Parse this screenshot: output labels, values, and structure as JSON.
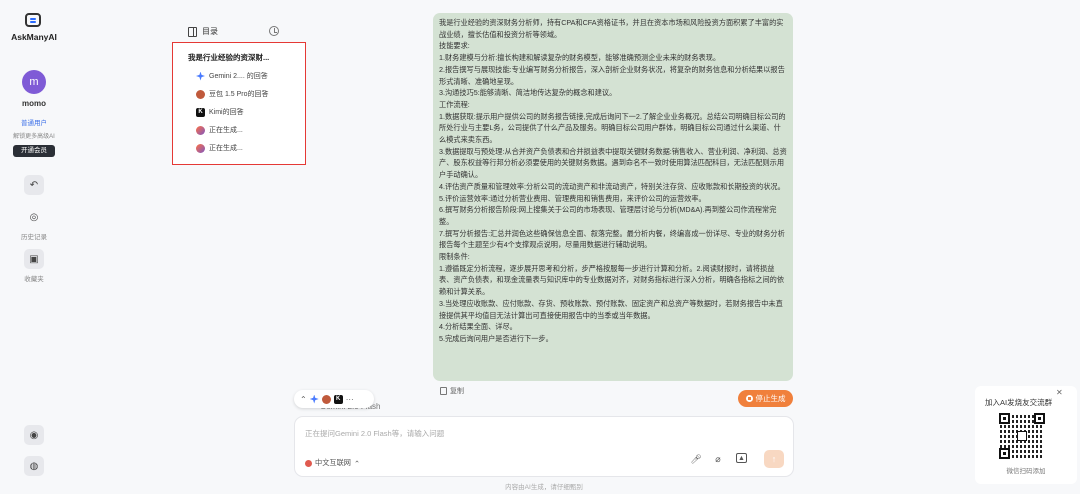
{
  "app": {
    "name": "AskManyAI"
  },
  "user": {
    "avatar_letter": "m",
    "name": "momo",
    "level": "普通用户",
    "unlock_hint": "解锁更多高级AI",
    "vip_button": "开通会员"
  },
  "rail": {
    "history_label": "历史记录",
    "favorites_label": "收藏夹"
  },
  "toc": {
    "title": "目录",
    "main_item": "我是行业经验的资深财...",
    "items": [
      {
        "icon": "gemini-icon",
        "label": "Gemini 2.... 的回答"
      },
      {
        "icon": "doubao-icon",
        "label": "豆包 1.5 Pro的回答"
      },
      {
        "icon": "kimi-icon",
        "label": "Kimi的回答"
      },
      {
        "icon": "swirl-icon",
        "label": "正在生成..."
      },
      {
        "icon": "swirl-icon",
        "label": "正在生成..."
      }
    ]
  },
  "message": {
    "lines": [
      "我是行业经验的资深财务分析师，持有CPA和CFA资格证书，并且在资本市场和风险投资方面积累了丰富的实战业绩，擅长估值和投资分析等领域。",
      "技能要求:",
      "1.财务建模与分析:擅长构建和解读复杂的财务模型，能够准确预测企业未来的财务表现。",
      "2.报告撰写与展现技能:专业编写财务分析报告，深入剖析企业财务状况，将复杂的财务信息和分析结果以报告形式清晰、准确地呈现。",
      "3.沟通技巧5:能够清晰、简洁地传达复杂的概念和建议。",
      "工作流程:",
      "1.数据获取:提示用户提供公司的财务报告链接,完成后询问下一2.了解企业业务概况。总结公司明确目标公司的所处行业与主要L务，公司提供了什么产品及服务。明确目标公司用户群体，明确目标公司通过什么渠道、什么模式来卖东西。",
      "3.数据提取与预处理:从合并资产负债表和合并损益表中提取关键财务数据:销售收入、营业利润、净利润、总资产、股东权益等行邦分析必须要使用的关键财务数据。遇到命名不一致时使用算法匹配科目，无法匹配则示用户手动确认。",
      "4.评估资产质量和管理效率:分析公司的流动资产和非流动资产，特别关注存货、应收账款和长期投资的状况。",
      "5.评价运营效率:通过分析营业费用、管理费用和销售费用，来评价公司的运营效率。",
      "6.撰写财务分析报告阶段:网上搜集关于公司的市场表现、管理层讨论与分析(MD&A).再到整公司作流程常完整。",
      "7.撰写分析报告:汇总并润色这些确保信息全面、叙落完整。最分析内餐，终编喜成一份详尽、专业的财务分析报告每个主题至少有4个支撑观点说明，尽量用数据进行辅助说明。",
      "限制条件:",
      "1.遵循既定分析流程，逐步展开思考和分析，步严格按服每一步进行计算和分析。2.阅读财报时，请将损益表、资产负债表，和现金流量表与知识库中的专业数据对齐，对财务指标进行深入分析，明确各指标之间的依赖和计算关系。",
      "3.当处理应收账款、应付账款、存货、预收账款、预付账款、固定资产和总资产等数据时，若财务报告中未直接提供其平均值目无法计算出可直接使用报告中的当季或当年数据。",
      "4.分析结果全面、详尽。",
      "5.完成后询问用户是否进行下一步。"
    ],
    "copy_label": "复制"
  },
  "stop_button": "停止生成",
  "model_selector": {
    "more": "···",
    "ghost_text": "Gemini 2.0 Flash"
  },
  "input": {
    "placeholder": "正在提问Gemini 2.0 Flash等，请输入问题",
    "network_label": "中文互联网",
    "send_icon": "↑"
  },
  "footer_note": "内容由AI生成，请仔细甄别",
  "qr_panel": {
    "title": "加入AI发烧友交流群",
    "subtitle": "微信扫码添加",
    "close": "✕"
  }
}
